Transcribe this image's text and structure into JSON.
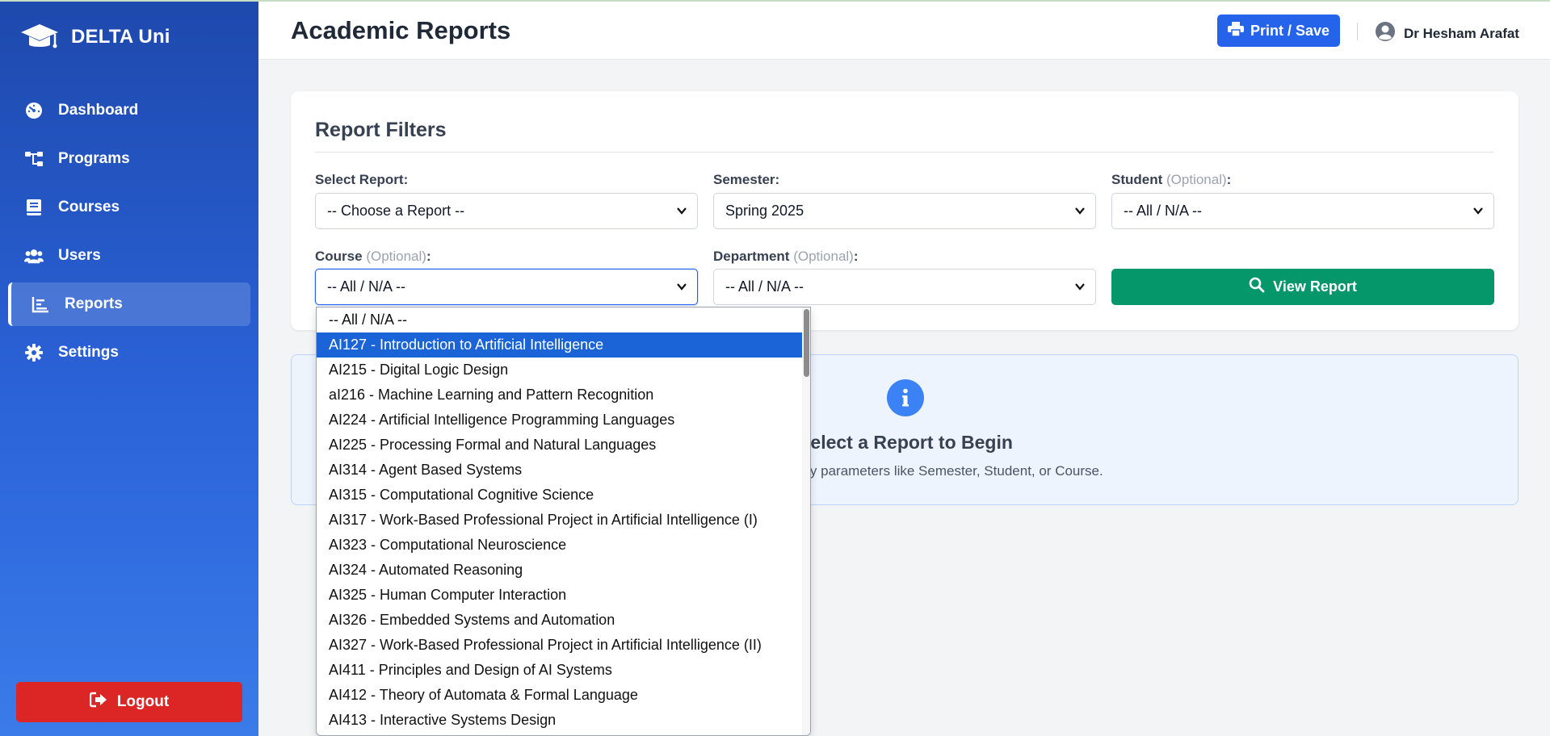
{
  "app": {
    "brand": "DELTA Uni"
  },
  "sidebar": {
    "items": [
      {
        "label": "Dashboard",
        "icon": "gauge-icon"
      },
      {
        "label": "Programs",
        "icon": "sitemap-icon"
      },
      {
        "label": "Courses",
        "icon": "book-icon"
      },
      {
        "label": "Users",
        "icon": "users-icon"
      },
      {
        "label": "Reports",
        "icon": "chart-line-icon",
        "active": true
      },
      {
        "label": "Settings",
        "icon": "gear-icon"
      }
    ],
    "logout_label": "Logout"
  },
  "header": {
    "title": "Academic Reports",
    "print_label": "Print / Save",
    "user_name": "Dr Hesham Arafat"
  },
  "filters": {
    "title": "Report Filters",
    "report": {
      "label": "Select Report:",
      "value": "-- Choose a Report --"
    },
    "semester": {
      "label": "Semester:",
      "value": "Spring 2025"
    },
    "student": {
      "label": "Student",
      "optional": "(Optional)",
      "colon": ":",
      "value": "-- All / N/A --"
    },
    "course": {
      "label": "Course",
      "optional": "(Optional)",
      "colon": ":",
      "value": "-- All / N/A --"
    },
    "department": {
      "label": "Department",
      "optional": "(Optional)",
      "colon": ":",
      "value": "-- All / N/A --"
    },
    "view_label": "View Report"
  },
  "info": {
    "heading": "Select a Report to Begin",
    "text": "report and specify parameters like Semester, Student, or Course."
  },
  "course_options": [
    "-- All / N/A --",
    "AI127 - Introduction to Artificial Intelligence",
    "AI215 - Digital Logic Design",
    "aI216 - Machine Learning and Pattern Recognition",
    "AI224 - Artificial Intelligence Programming Languages",
    "AI225 - Processing Formal and Natural Languages",
    "AI314 - Agent Based Systems",
    "AI315 - Computational Cognitive Science",
    "AI317 - Work-Based Professional Project in Artificial Intelligence (I)",
    "AI323 - Computational Neuroscience",
    "AI324 - Automated Reasoning",
    "AI325 - Human Computer Interaction",
    "AI326 - Embedded Systems and Automation",
    "AI327 - Work-Based Professional Project in Artificial Intelligence (II)",
    "AI411 - Principles and Design of AI Systems",
    "AI412 - Theory of Automata & Formal Language",
    "AI413 - Interactive Systems Design"
  ],
  "course_highlighted_index": 1,
  "colors": {
    "primary": "#2563eb",
    "success": "#059669",
    "danger": "#dc2626",
    "highlight": "#1a64d8"
  }
}
